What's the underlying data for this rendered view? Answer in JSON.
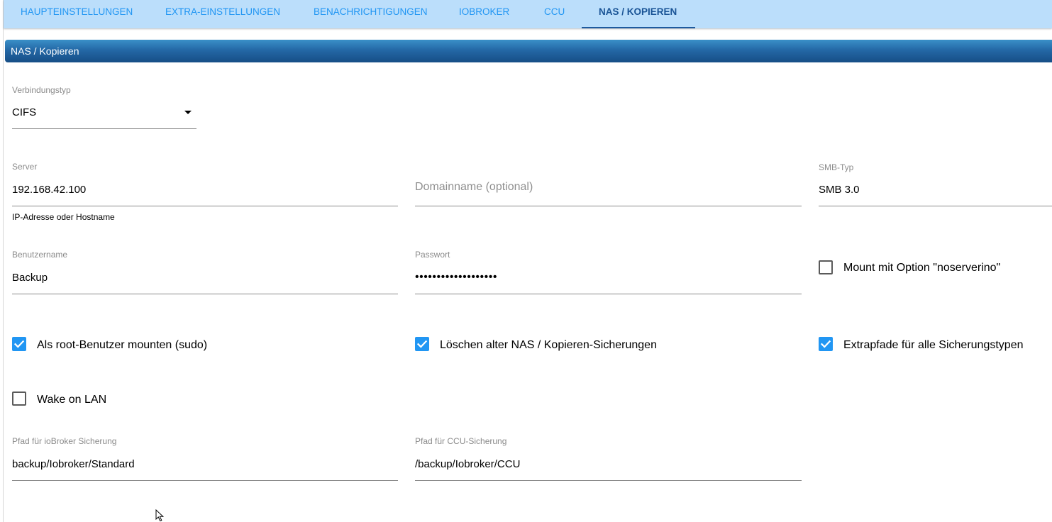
{
  "tabs": [
    {
      "label": "HAUPTEINSTELLUNGEN",
      "active": false
    },
    {
      "label": "EXTRA-EINSTELLUNGEN",
      "active": false
    },
    {
      "label": "BENACHRICHTIGUNGEN",
      "active": false
    },
    {
      "label": "IOBROKER",
      "active": false
    },
    {
      "label": "CCU",
      "active": false
    },
    {
      "label": "NAS / KOPIEREN",
      "active": true
    }
  ],
  "section": {
    "title": "NAS / Kopieren"
  },
  "connection_type": {
    "label": "Verbindungstyp",
    "value": "CIFS"
  },
  "server": {
    "label": "Server",
    "value": "192.168.42.100",
    "helper": "IP-Adresse oder Hostname"
  },
  "domain": {
    "placeholder": "Domainname (optional)"
  },
  "smb_type": {
    "label": "SMB-Typ",
    "value": "SMB 3.0"
  },
  "username": {
    "label": "Benutzername",
    "value": "Backup"
  },
  "password": {
    "label": "Passwort",
    "value": "•••••••••••••••••••"
  },
  "checkboxes": {
    "noserverino": {
      "label": "Mount mit Option \"noserverino\"",
      "checked": false
    },
    "sudo": {
      "label": "Als root-Benutzer mounten (sudo)",
      "checked": true
    },
    "delete_old": {
      "label": "Löschen alter NAS / Kopieren-Sicherungen",
      "checked": true
    },
    "extra_paths": {
      "label": "Extrapfade für alle Sicherungstypen",
      "checked": true
    },
    "wol": {
      "label": "Wake on LAN",
      "checked": false
    }
  },
  "iobroker_path": {
    "label": "Pfad für ioBroker Sicherung",
    "value": "backup/Iobroker/Standard"
  },
  "ccu_path": {
    "label": "Pfad für CCU-Sicherung",
    "value": "/backup/Iobroker/CCU"
  },
  "colors": {
    "tabbar_bg": "#bbdefb",
    "tab_text": "#2196f3",
    "tab_active": "#1a5496",
    "header_bar": "#2468a6",
    "checkbox_checked": "#2196f3"
  },
  "icons": {
    "dropdown": "caret-down-icon",
    "checkbox_checked": "check-icon",
    "cursor": "mouse-pointer-icon"
  }
}
